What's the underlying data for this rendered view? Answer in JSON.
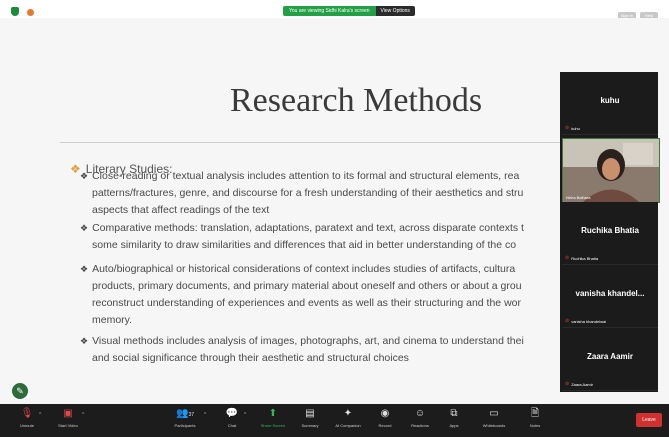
{
  "banner": {
    "sharing_text": "You are viewing Sidhi Kalra's screen",
    "view_options": "View Options"
  },
  "topright": {
    "btn1": "Sign in",
    "btn2": "Help"
  },
  "slide": {
    "title": "Research Methods",
    "heading": "Literary Studies:",
    "bullets": [
      [
        "Close-reading or textual analysis includes attention to its formal and structural elements, rea",
        "patterns/fractures, genre, and discourse for a fresh understanding of their aesthetics and stru",
        "aspects that affect readings of the text"
      ],
      [
        "Comparative methods: translation, adaptations, paratext and text, across disparate contexts t",
        "some similarity to draw similarities and differences that aid in better understanding of the co"
      ],
      [
        "Auto/biographical or historical considerations of context includes studies of artifacts, cultura",
        "products, primary documents, and primary material about oneself and others or about a grou",
        "reconstruct understanding of experiences and events as well as their structuring and the wor",
        "memory."
      ],
      [
        "Visual methods includes analysis of images, photographs, art, and cinema to understand thei",
        "and social significance through their aesthetic and structural choices"
      ]
    ]
  },
  "participants": [
    {
      "name": "kuhu",
      "label": "kuhu"
    },
    {
      "name": "",
      "label": "Neha Balhara"
    },
    {
      "name": "Ruchika Bhatia",
      "label": "Ruchika Bhatia"
    },
    {
      "name": "vanisha khandel...",
      "label": "vanisha khandelwal"
    },
    {
      "name": "Zaara Aamir",
      "label": "Zaara Aamir"
    }
  ],
  "toolbar": {
    "unmute": "Unmute",
    "start_video": "Start Video",
    "participants": "Participants",
    "participants_count": "37",
    "chat": "Chat",
    "share_screen": "Share Screen",
    "summary": "Summary",
    "ai_companion": "AI Companion",
    "record": "Record",
    "reactions": "Reactions",
    "apps": "Apps",
    "whiteboards": "Whiteboards",
    "notes": "Notes",
    "leave": "Leave"
  },
  "colors": {
    "share_green": "#23a045",
    "leave_red": "#d03030",
    "bullet_star": "#e0a23a"
  }
}
